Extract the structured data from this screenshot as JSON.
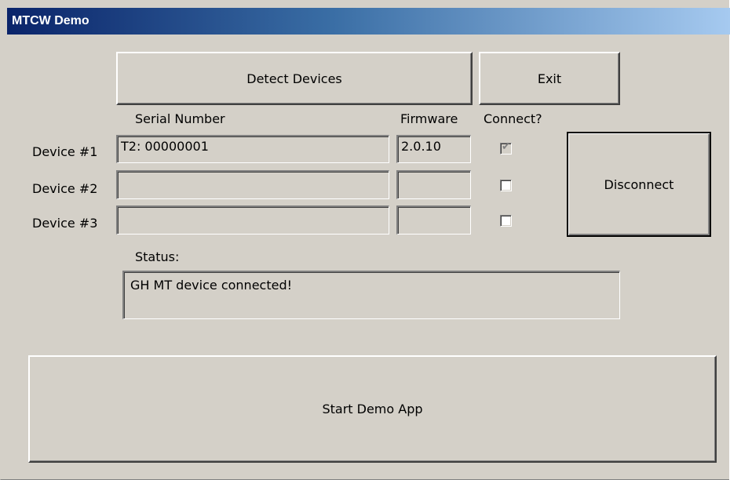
{
  "window": {
    "title": "MTCW Demo"
  },
  "buttons": {
    "detect": "Detect Devices",
    "exit": "Exit",
    "disconnect": "Disconnect",
    "start": "Start Demo App"
  },
  "headers": {
    "serial": "Serial Number",
    "firmware": "Firmware",
    "connect": "Connect?"
  },
  "devices": [
    {
      "label": "Device #1",
      "serial": "T2: 00000001",
      "firmware": "2.0.10",
      "connected": true
    },
    {
      "label": "Device #2",
      "serial": "",
      "firmware": "",
      "connected": false
    },
    {
      "label": "Device #3",
      "serial": "",
      "firmware": "",
      "connected": false
    }
  ],
  "status": {
    "label": "Status:",
    "text": "GH MT device connected!"
  }
}
